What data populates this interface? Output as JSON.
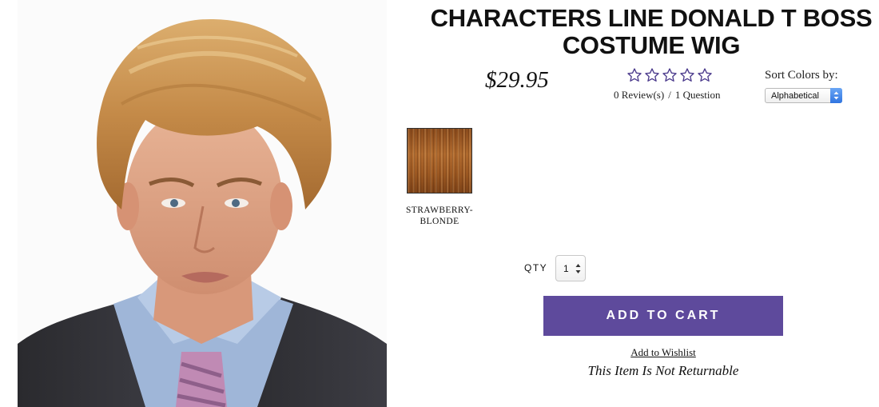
{
  "product": {
    "title": "CHARACTERS LINE DONALD T BOSS COSTUME WIG",
    "price": "$29.95",
    "rating": {
      "stars_filled": 0,
      "stars_total": 5,
      "reviews_text": "0 Review(s)",
      "separator": "/",
      "questions_text": "1 Question"
    },
    "image_icon": "wig-model-photo"
  },
  "sort_colors": {
    "label": "Sort Colors by:",
    "selected": "Alphabetical"
  },
  "swatches": [
    {
      "label": "STRAWBERRY-\nBLONDE",
      "color": "#a3602a"
    }
  ],
  "qty": {
    "label": "QTY",
    "value": "1"
  },
  "actions": {
    "add_to_cart": "ADD TO CART",
    "wishlist": "Add to Wishlist",
    "return_note": "This Item Is Not Returnable"
  },
  "colors": {
    "accent": "#5e4a9c",
    "star_outline": "#4b3a8c",
    "select_spinner": "#2f74e0"
  }
}
